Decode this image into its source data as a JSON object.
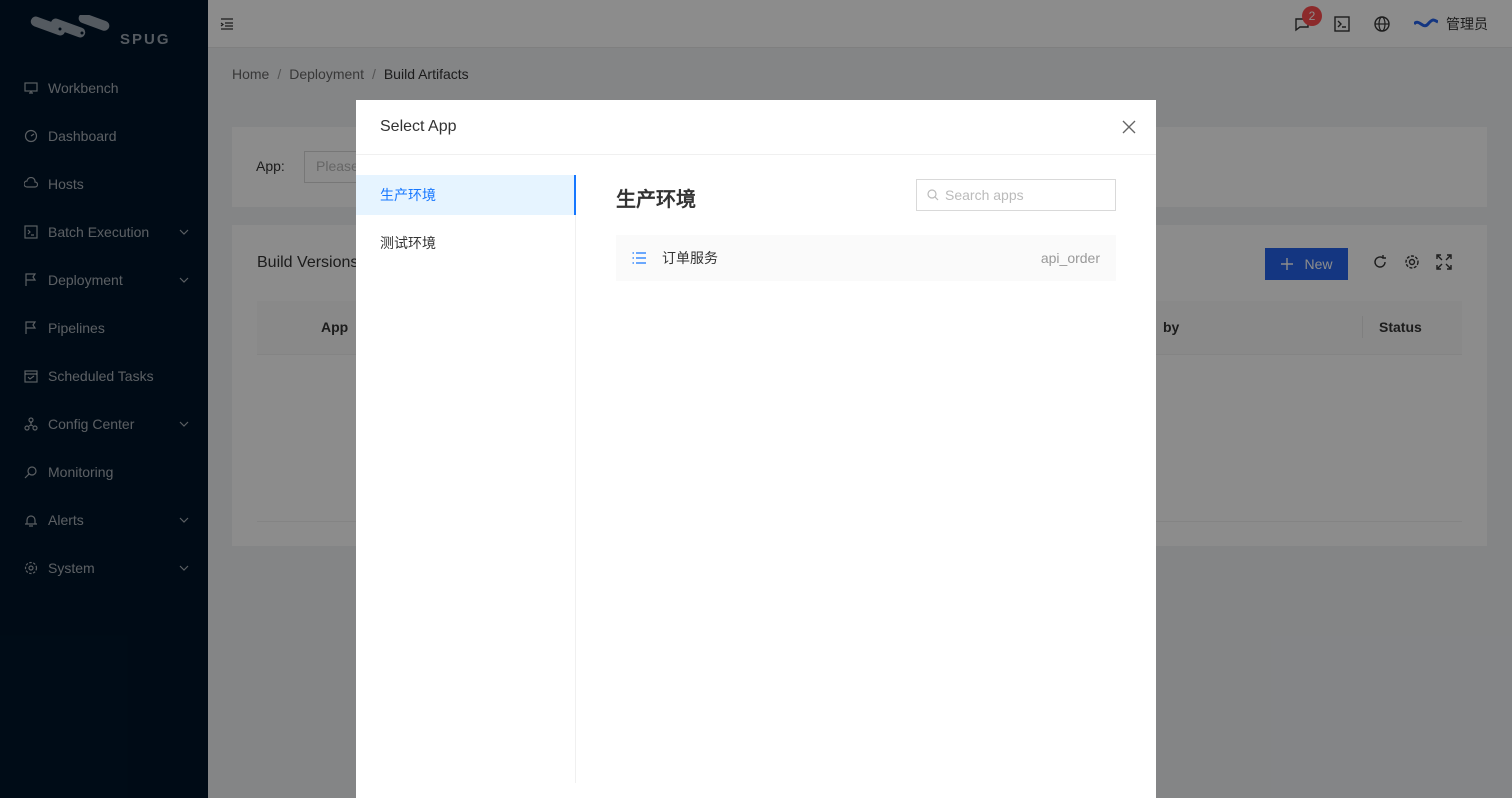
{
  "logo": {
    "text": "SPUG"
  },
  "sidebar": {
    "items": [
      {
        "label": "Workbench",
        "icon": "desktop-icon",
        "has_submenu": false
      },
      {
        "label": "Dashboard",
        "icon": "dashboard-icon",
        "has_submenu": false
      },
      {
        "label": "Hosts",
        "icon": "cloud-server-icon",
        "has_submenu": false
      },
      {
        "label": "Batch Execution",
        "icon": "code-icon",
        "has_submenu": true
      },
      {
        "label": "Deployment",
        "icon": "flag-icon",
        "has_submenu": true
      },
      {
        "label": "Pipelines",
        "icon": "pipeline-icon",
        "has_submenu": false
      },
      {
        "label": "Scheduled Tasks",
        "icon": "schedule-icon",
        "has_submenu": false
      },
      {
        "label": "Config Center",
        "icon": "deployment-unit-icon",
        "has_submenu": true
      },
      {
        "label": "Monitoring",
        "icon": "monitor-icon",
        "has_submenu": false
      },
      {
        "label": "Alerts",
        "icon": "alert-icon",
        "has_submenu": true
      },
      {
        "label": "System",
        "icon": "setting-icon",
        "has_submenu": true
      }
    ]
  },
  "header": {
    "notification_count": "2",
    "username": "管理员"
  },
  "breadcrumb": {
    "items": [
      "Home",
      "Deployment",
      "Build Artifacts"
    ]
  },
  "filter": {
    "app_label": "App:",
    "app_placeholder": "Please"
  },
  "build_card": {
    "title": "Build Versions",
    "new_button": "New",
    "columns": [
      "App",
      "by",
      "Status"
    ]
  },
  "modal": {
    "title": "Select App",
    "tabs": [
      "生产环境",
      "测试环境"
    ],
    "active_tab": "生产环境",
    "env_title": "生产环境",
    "search_placeholder": "Search apps",
    "apps": [
      {
        "name": "订单服务",
        "key": "api_order"
      }
    ]
  },
  "colors": {
    "sidebar_bg": "#001529",
    "accent": "#1677ff",
    "primary_button": "#2563eb",
    "badge": "#ff4d4f"
  }
}
